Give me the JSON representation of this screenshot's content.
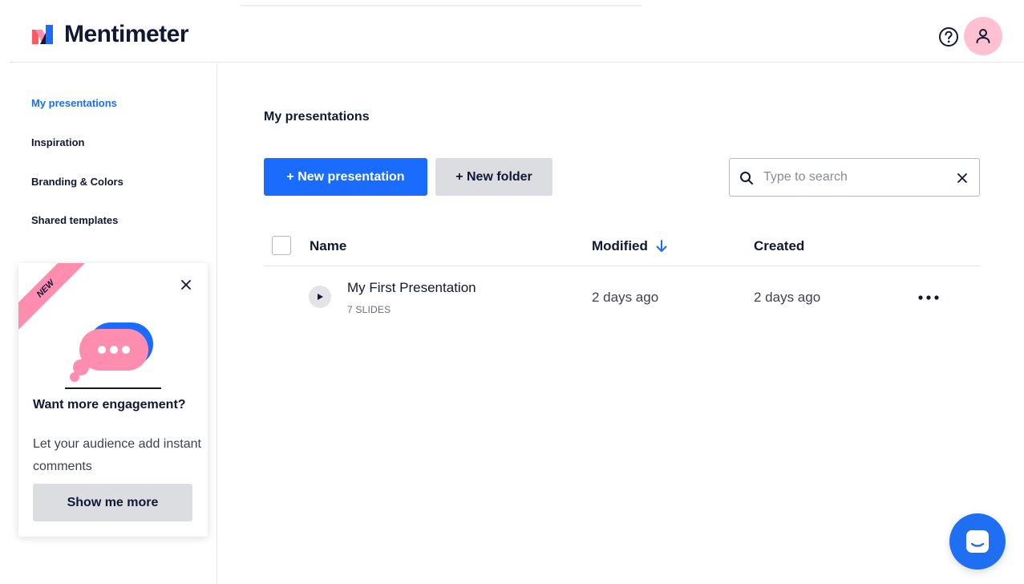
{
  "app": {
    "name": "Mentimeter"
  },
  "sidebar": {
    "items": [
      {
        "label": "My presentations",
        "active": true
      },
      {
        "label": "Inspiration",
        "active": false
      },
      {
        "label": "Branding & Colors",
        "active": false
      },
      {
        "label": "Shared templates",
        "active": false
      }
    ]
  },
  "promo": {
    "ribbon": "NEW",
    "title": "Want more engagement?",
    "description": "Let your audience add instant comments",
    "button": "Show me more"
  },
  "main": {
    "title": "My presentations",
    "new_presentation": "+ New presentation",
    "new_folder": "+ New folder",
    "search": {
      "placeholder": "Type to search",
      "value": ""
    },
    "columns": {
      "name": "Name",
      "modified": "Modified",
      "created": "Created"
    },
    "rows": [
      {
        "name": "My First Presentation",
        "slides": "7 SLIDES",
        "modified": "2 days ago",
        "created": "2 days ago"
      }
    ]
  },
  "colors": {
    "accent": "#196cff",
    "avatar_bg": "#ffc0d2",
    "ribbon": "#ff8db0",
    "chat": "#1f6ff2"
  },
  "icons": [
    "logo-icon",
    "help-icon",
    "user-icon",
    "close-icon",
    "search-icon",
    "clear-icon",
    "sort-down-arrow-icon",
    "play-icon",
    "more-icon",
    "chat-icon",
    "speech-bubble-illustration"
  ]
}
